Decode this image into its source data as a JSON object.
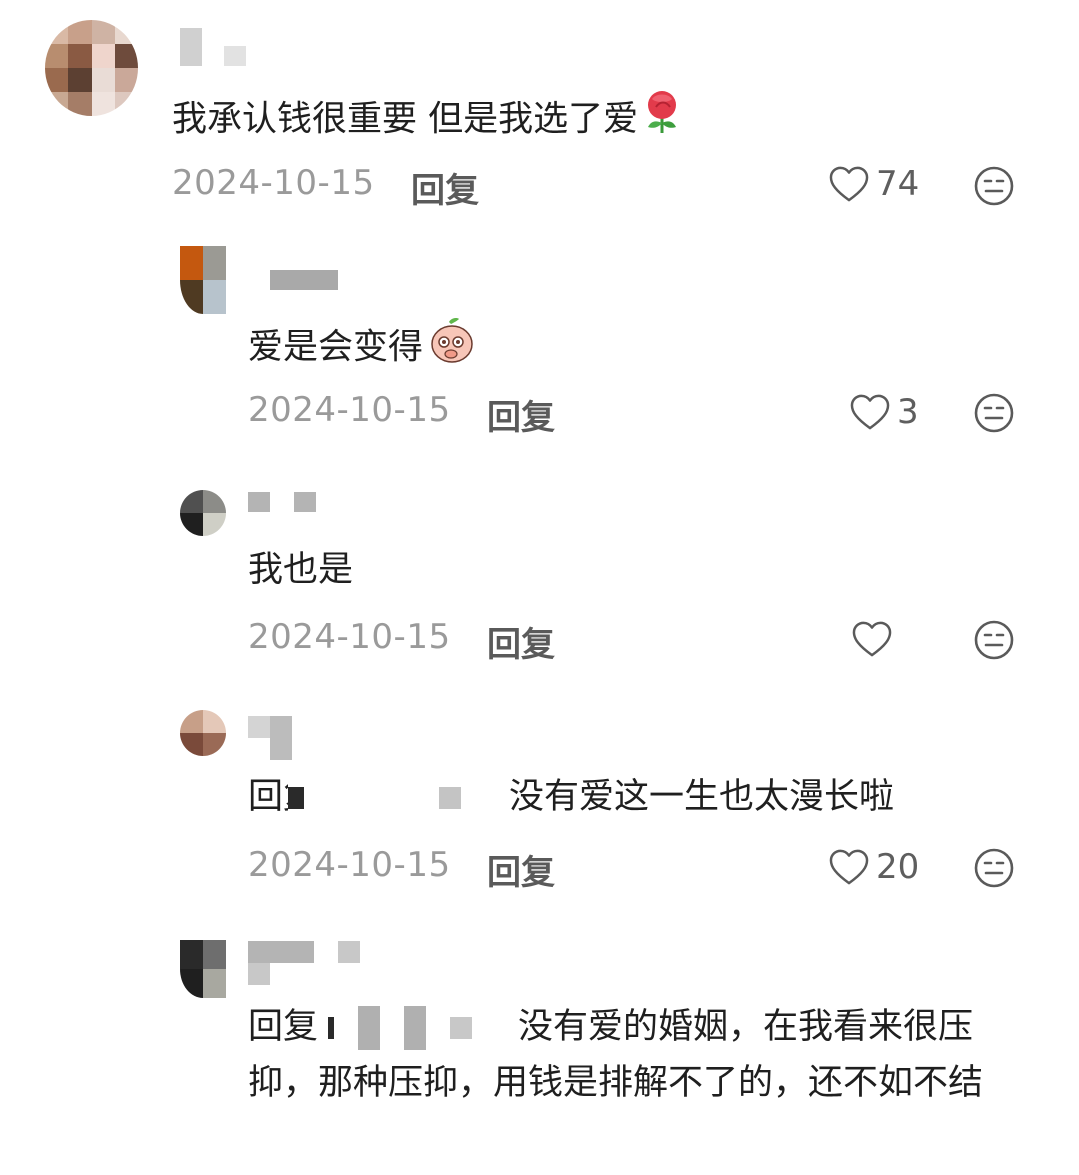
{
  "comments": [
    {
      "text": "我承认钱很重要 但是我选了爱",
      "date": "2024-10-15",
      "reply_label": "回复",
      "likes": "74",
      "emoji": "rose-icon"
    },
    {
      "text": "爱是会变得",
      "date": "2024-10-15",
      "reply_label": "回复",
      "likes": "3",
      "emoji": "peach-face-icon"
    },
    {
      "text": "我也是",
      "date": "2024-10-15",
      "reply_label": "回复",
      "likes": ""
    },
    {
      "reply_prefix": "回复",
      "text": "没有爱这一生也太漫长啦",
      "date": "2024-10-15",
      "reply_label": "回复",
      "likes": "20"
    },
    {
      "reply_prefix": "回复",
      "text": "没有爱的婚姻，在我看来很",
      "text_rest": "压抑，那种压抑，用钱是排解不了的，还不如不结"
    }
  ],
  "colors": {
    "text": "#1f1f1f",
    "meta": "#9a9a9a",
    "action": "#5a5a5a"
  }
}
